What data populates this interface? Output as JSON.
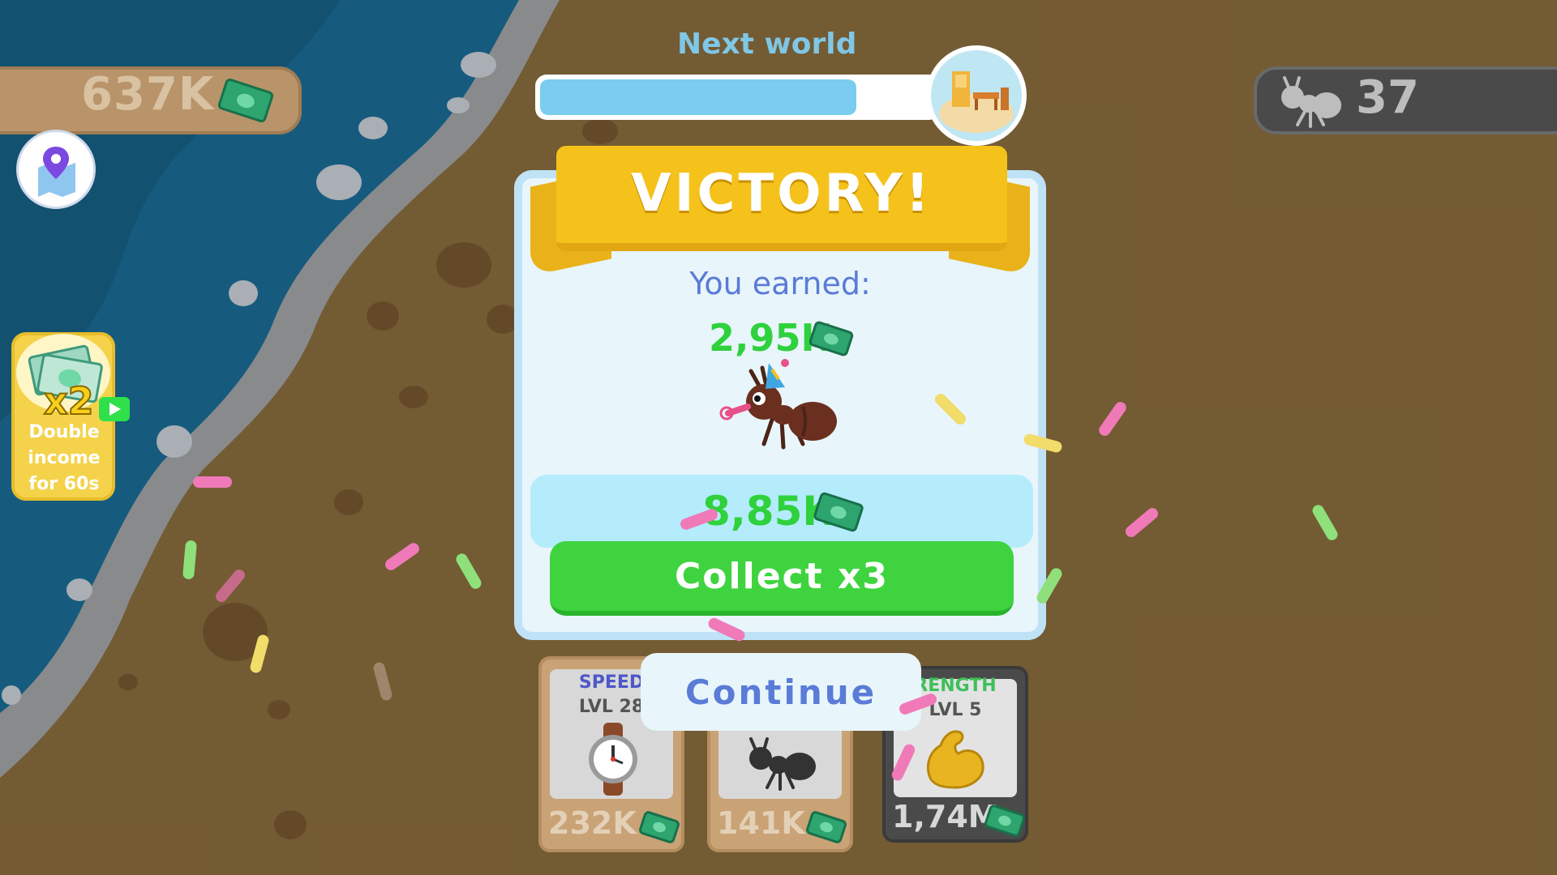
{
  "hud": {
    "money": "637K",
    "ant_count": "37",
    "next_world_label": "Next world",
    "next_world_progress": 0.8
  },
  "booster": {
    "multiplier": "x2",
    "text": "Double\nincome\nfor 60s"
  },
  "dialog": {
    "title": "VICTORY!",
    "earned_label": "You earned:",
    "earned_value": "2,95K",
    "bonus_value": "8,85K",
    "collect_label": "Collect x3",
    "continue_label": "Continue"
  },
  "upgrades": [
    {
      "name": "SPEED",
      "level": "LVL 28",
      "price": "232K",
      "icon": "watch-icon",
      "name_color": "#4d57c7"
    },
    {
      "name": "",
      "level": "",
      "price": "141K",
      "icon": "ant-icon",
      "name_color": "#555555"
    },
    {
      "name": "RENGTH",
      "level": "LVL 5",
      "price": "1,74M",
      "icon": "flexed-biceps-icon",
      "name_color": "#3fbf59"
    }
  ],
  "colors": {
    "sand": "#8d6f3f",
    "water": "#1b6f9a",
    "accent_green": "#3fd43f",
    "ribbon_yellow": "#f5c21b",
    "text_blue": "#5a7bd6"
  }
}
